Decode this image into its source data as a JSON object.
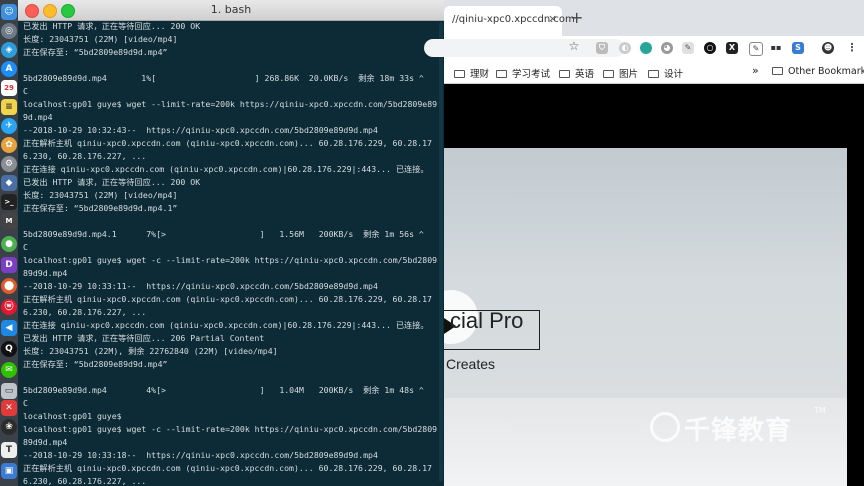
{
  "terminal": {
    "title": "1. bash",
    "lines": [
      "已发出 HTTP 请求，正在等待回应... 200 OK",
      "长度: 23043751 (22M) [video/mp4]",
      "正在保存至: “5bd2809e89d9d.mp4”",
      "",
      "5bd2809e89d9d.mp4       1%[                    ] 268.86K  20.0KB/s  剩余 18m 33s ^",
      "C",
      "localhost:gp01 guye$ wget --limit-rate=200k https://qiniu-xpc0.xpccdn.com/5bd2809e89d",
      "9d.mp4",
      "--2018-10-29 10:32:43--  https://qiniu-xpc0.xpccdn.com/5bd2809e89d9d.mp4",
      "正在解析主机 qiniu-xpc0.xpccdn.com (qiniu-xpc0.xpccdn.com)... 60.28.176.229, 60.28.17",
      "6.230, 60.28.176.227, ...",
      "正在连接 qiniu-xpc0.xpccdn.com (qiniu-xpc0.xpccdn.com)|60.28.176.229|:443... 已连接。",
      "已发出 HTTP 请求，正在等待回应... 200 OK",
      "长度: 23043751 (22M) [video/mp4]",
      "正在保存至: “5bd2809e89d9d.mp4.1”",
      "",
      "5bd2809e89d9d.mp4.1      7%[>                   ]   1.56M   200KB/s  剩余 1m 56s ^",
      "C",
      "localhost:gp01 guye$ wget -c --limit-rate=200k https://qiniu-xpc0.xpccdn.com/5bd2809e",
      "89d9d.mp4",
      "--2018-10-29 10:33:11--  https://qiniu-xpc0.xpccdn.com/5bd2809e89d9d.mp4",
      "正在解析主机 qiniu-xpc0.xpccdn.com (qiniu-xpc0.xpccdn.com)... 60.28.176.229, 60.28.17",
      "6.230, 60.28.176.227, ...",
      "正在连接 qiniu-xpc0.xpccdn.com (qiniu-xpc0.xpccdn.com)|60.28.176.229|:443... 已连接。",
      "已发出 HTTP 请求，正在等待回应... 206 Partial Content",
      "长度: 23043751 (22M), 剩余 22762840 (22M) [video/mp4]",
      "正在保存至: “5bd2809e89d9d.mp4”",
      "",
      "5bd2809e89d9d.mp4        4%[>                   ]   1.04M   200KB/s  剩余 1m 48s ^",
      "C",
      "localhost:gp01 guye$",
      "localhost:gp01 guye$ wget -c --limit-rate=200k https://qiniu-xpc0.xpccdn.com/5bd2809e",
      "89d9d.mp4",
      "--2018-10-29 10:33:18--  https://qiniu-xpc0.xpccdn.com/5bd2809e89d9d.mp4",
      "正在解析主机 qiniu-xpc0.xpccdn.com (qiniu-xpc0.xpccdn.com)... 60.28.176.229, 60.28.17",
      "6.230, 60.28.176.227, ..."
    ]
  },
  "browser": {
    "tab_title": "//qiniu-xpc0.xpccdn.com",
    "tab_close": "×",
    "new_tab": "+",
    "bookmarks": [
      "理财",
      "学习考试",
      "英语",
      "图片",
      "设计"
    ],
    "bookmarks_more": "»",
    "other_bookmarks": "Other Bookmarks",
    "video": {
      "logo_text": "cial Pro",
      "logo_sub": "Creates",
      "watermark": "千锋教育",
      "watermark_tm": "TM"
    }
  },
  "dock": {
    "icons": [
      "finder-icon",
      "launchpad-icon",
      "safari-icon",
      "appstore-icon",
      "calendar-icon",
      "notes-icon",
      "app-icon",
      "photos-icon",
      "preferences-icon",
      "terminal-icon",
      "chrome-icon",
      "dictionary-icon",
      "app-icon",
      "weibo-icon",
      "app-icon",
      "vscode-icon",
      "qq-icon",
      "wechat-icon",
      "app-icon",
      "xmind-icon",
      "app-icon",
      "typora-icon",
      "app-icon"
    ]
  }
}
